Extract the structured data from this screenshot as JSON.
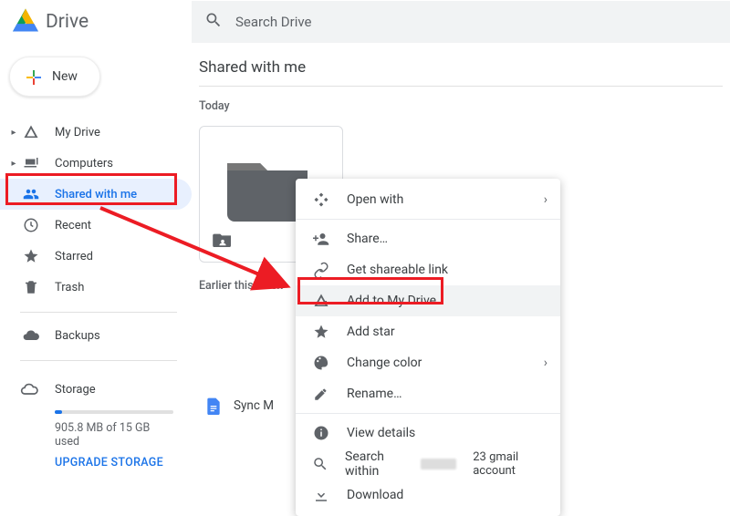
{
  "app": {
    "title": "Drive"
  },
  "search": {
    "placeholder": "Search Drive"
  },
  "new_button": {
    "label": "New"
  },
  "sidebar": {
    "items": [
      {
        "label": "My Drive"
      },
      {
        "label": "Computers"
      },
      {
        "label": "Shared with me"
      },
      {
        "label": "Recent"
      },
      {
        "label": "Starred"
      },
      {
        "label": "Trash"
      },
      {
        "label": "Backups"
      }
    ],
    "storage": {
      "title": "Storage",
      "used_text": "905.8 MB of 15 GB used",
      "upgrade": "UPGRADE STORAGE"
    }
  },
  "main": {
    "title": "Shared with me",
    "section_today": "Today",
    "section_earlier": "Earlier this week",
    "doc_name": "Sync M"
  },
  "context_menu": {
    "open_with": "Open with",
    "share": "Share…",
    "get_link": "Get shareable link",
    "add_drive": "Add to My Drive",
    "add_star": "Add star",
    "change_color": "Change color",
    "rename": "Rename…",
    "view_details": "View details",
    "search_within": "Search within",
    "search_suffix": "23 gmail account",
    "download": "Download"
  }
}
